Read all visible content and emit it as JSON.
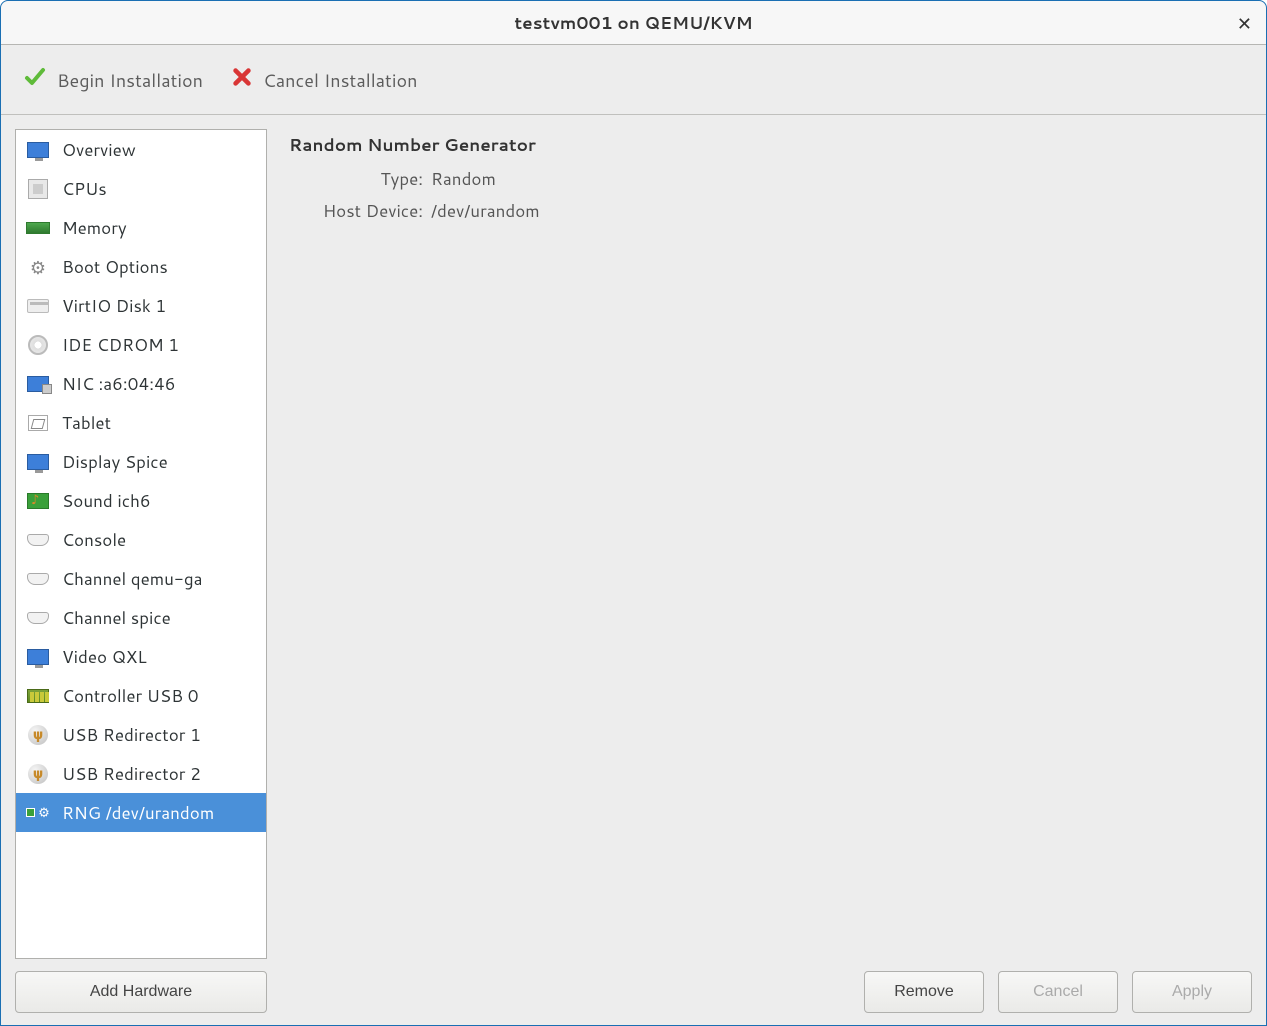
{
  "window": {
    "title": "testvm001 on QEMU/KVM"
  },
  "toolbar": {
    "begin_label": "Begin Installation",
    "cancel_label": "Cancel Installation"
  },
  "sidebar": {
    "items": [
      {
        "label": "Overview",
        "icon": "monitor",
        "selected": false
      },
      {
        "label": "CPUs",
        "icon": "cpu",
        "selected": false
      },
      {
        "label": "Memory",
        "icon": "mem",
        "selected": false
      },
      {
        "label": "Boot Options",
        "icon": "gears",
        "selected": false
      },
      {
        "label": "VirtIO Disk 1",
        "icon": "disk",
        "selected": false
      },
      {
        "label": "IDE CDROM 1",
        "icon": "cd",
        "selected": false
      },
      {
        "label": "NIC :a6:04:46",
        "icon": "nic",
        "selected": false
      },
      {
        "label": "Tablet",
        "icon": "tablet",
        "selected": false
      },
      {
        "label": "Display Spice",
        "icon": "monitor",
        "selected": false
      },
      {
        "label": "Sound ich6",
        "icon": "sound",
        "selected": false
      },
      {
        "label": "Console",
        "icon": "port",
        "selected": false
      },
      {
        "label": "Channel qemu-ga",
        "icon": "port",
        "selected": false
      },
      {
        "label": "Channel spice",
        "icon": "port",
        "selected": false
      },
      {
        "label": "Video QXL",
        "icon": "monitor",
        "selected": false
      },
      {
        "label": "Controller USB 0",
        "icon": "usb-bar",
        "selected": false
      },
      {
        "label": "USB Redirector 1",
        "icon": "usb",
        "selected": false
      },
      {
        "label": "USB Redirector 2",
        "icon": "usb",
        "selected": false
      },
      {
        "label": "RNG /dev/urandom",
        "icon": "rng",
        "selected": true
      }
    ],
    "add_hardware_label": "Add Hardware"
  },
  "detail": {
    "title": "Random Number Generator",
    "fields": [
      {
        "key": "Type:",
        "value": "Random"
      },
      {
        "key": "Host Device:",
        "value": "/dev/urandom"
      }
    ]
  },
  "footer": {
    "remove_label": "Remove",
    "cancel_label": "Cancel",
    "apply_label": "Apply"
  }
}
